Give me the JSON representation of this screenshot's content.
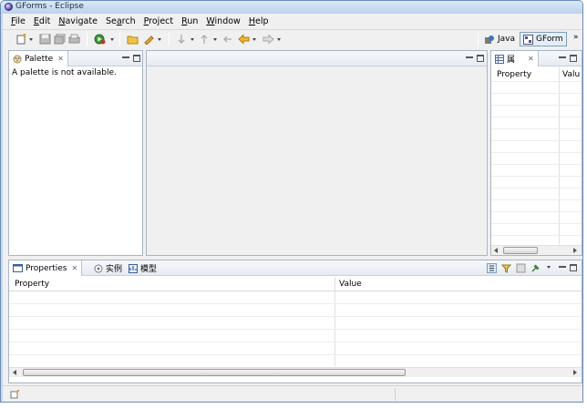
{
  "window": {
    "title": "GForms - Eclipse"
  },
  "menu": [
    {
      "label": "File",
      "mnemonic": "F",
      "rest": "ile"
    },
    {
      "label": "Edit",
      "mnemonic": "E",
      "rest": "dit"
    },
    {
      "label": "Navigate",
      "mnemonic": "N",
      "rest": "avigate"
    },
    {
      "label": "Search",
      "mnemonic": "a",
      "pre": "Se",
      "rest": "rch"
    },
    {
      "label": "Project",
      "mnemonic": "P",
      "rest": "roject"
    },
    {
      "label": "Run",
      "mnemonic": "R",
      "rest": "un"
    },
    {
      "label": "Window",
      "mnemonic": "W",
      "rest": "indow"
    },
    {
      "label": "Help",
      "mnemonic": "H",
      "rest": "elp"
    }
  ],
  "perspectives": {
    "java": "Java",
    "gforms": "GForm",
    "more": "»"
  },
  "palette": {
    "tab": "Palette",
    "message": "A palette is not available."
  },
  "outline": {
    "tab_title": "属",
    "columns": [
      "Property",
      "Valu"
    ]
  },
  "bottom": {
    "tabs": [
      "Properties",
      "实例",
      "模型"
    ],
    "columns": [
      "Property",
      "Value"
    ]
  },
  "colors": {
    "frame": "#c6d9ee",
    "view_border": "#a9b5c5",
    "accent": "#4b3b9a"
  },
  "icons": [
    "new-icon",
    "save-icon",
    "print-icon",
    "run-icon",
    "open-folder-icon",
    "pencil-icon",
    "back-icon",
    "forward-icon",
    "java-perspective-icon",
    "gforms-perspective-icon",
    "properties-view-icon",
    "instance-icon",
    "model-icon",
    "status-icon"
  ]
}
